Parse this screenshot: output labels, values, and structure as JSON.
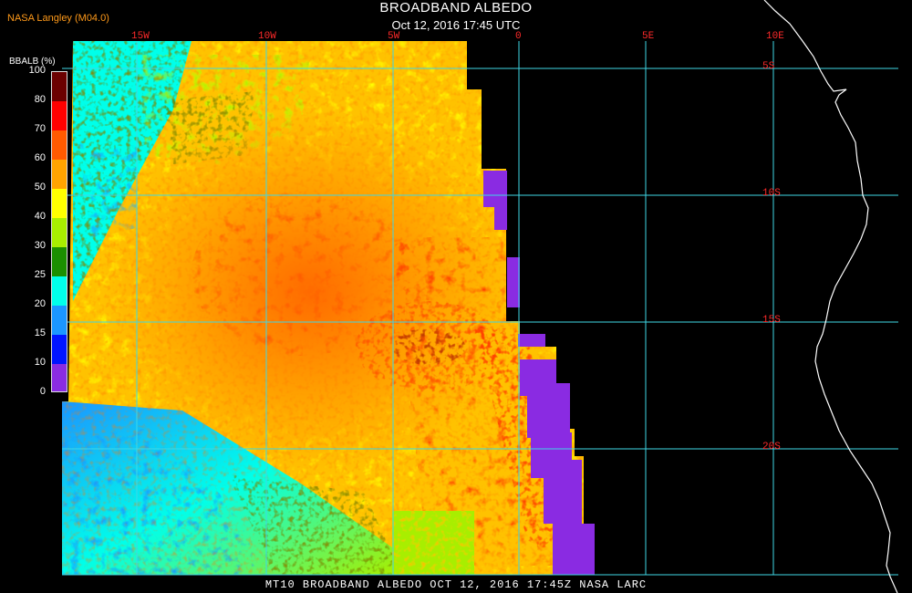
{
  "header": {
    "organization": "NASA Langley (M04.0)",
    "title": "BROADBAND ALBEDO",
    "subtitle": "Oct 12, 2016 17:45 UTC"
  },
  "footer": {
    "caption": "MT10  BROADBAND ALBEDO   OCT 12, 2016 17:45Z   NASA LARC"
  },
  "legend": {
    "title": "BBALB (%)",
    "labels": [
      "100",
      "80",
      "70",
      "60",
      "50",
      "40",
      "30",
      "25",
      "20",
      "15",
      "10",
      "0"
    ],
    "colors": [
      "#6b0000",
      "#ff0000",
      "#ff5a00",
      "#ffa400",
      "#ffff00",
      "#a8ee00",
      "#1b8f00",
      "#00ffea",
      "#1b96ff",
      "#0014ff",
      "#8a2be2"
    ]
  },
  "graticule": {
    "grid_color": "#3fd7e6",
    "label_color": "#ff2a2a",
    "longitudes": [
      "15W",
      "10W",
      "5W",
      "0",
      "5E",
      "10E"
    ],
    "latitudes": [
      "5S",
      "10S",
      "15S",
      "20S"
    ]
  },
  "map": {
    "coastline_color": "#ffffff",
    "no_data_color": "#000000",
    "purple_color": "#8a2be2"
  }
}
